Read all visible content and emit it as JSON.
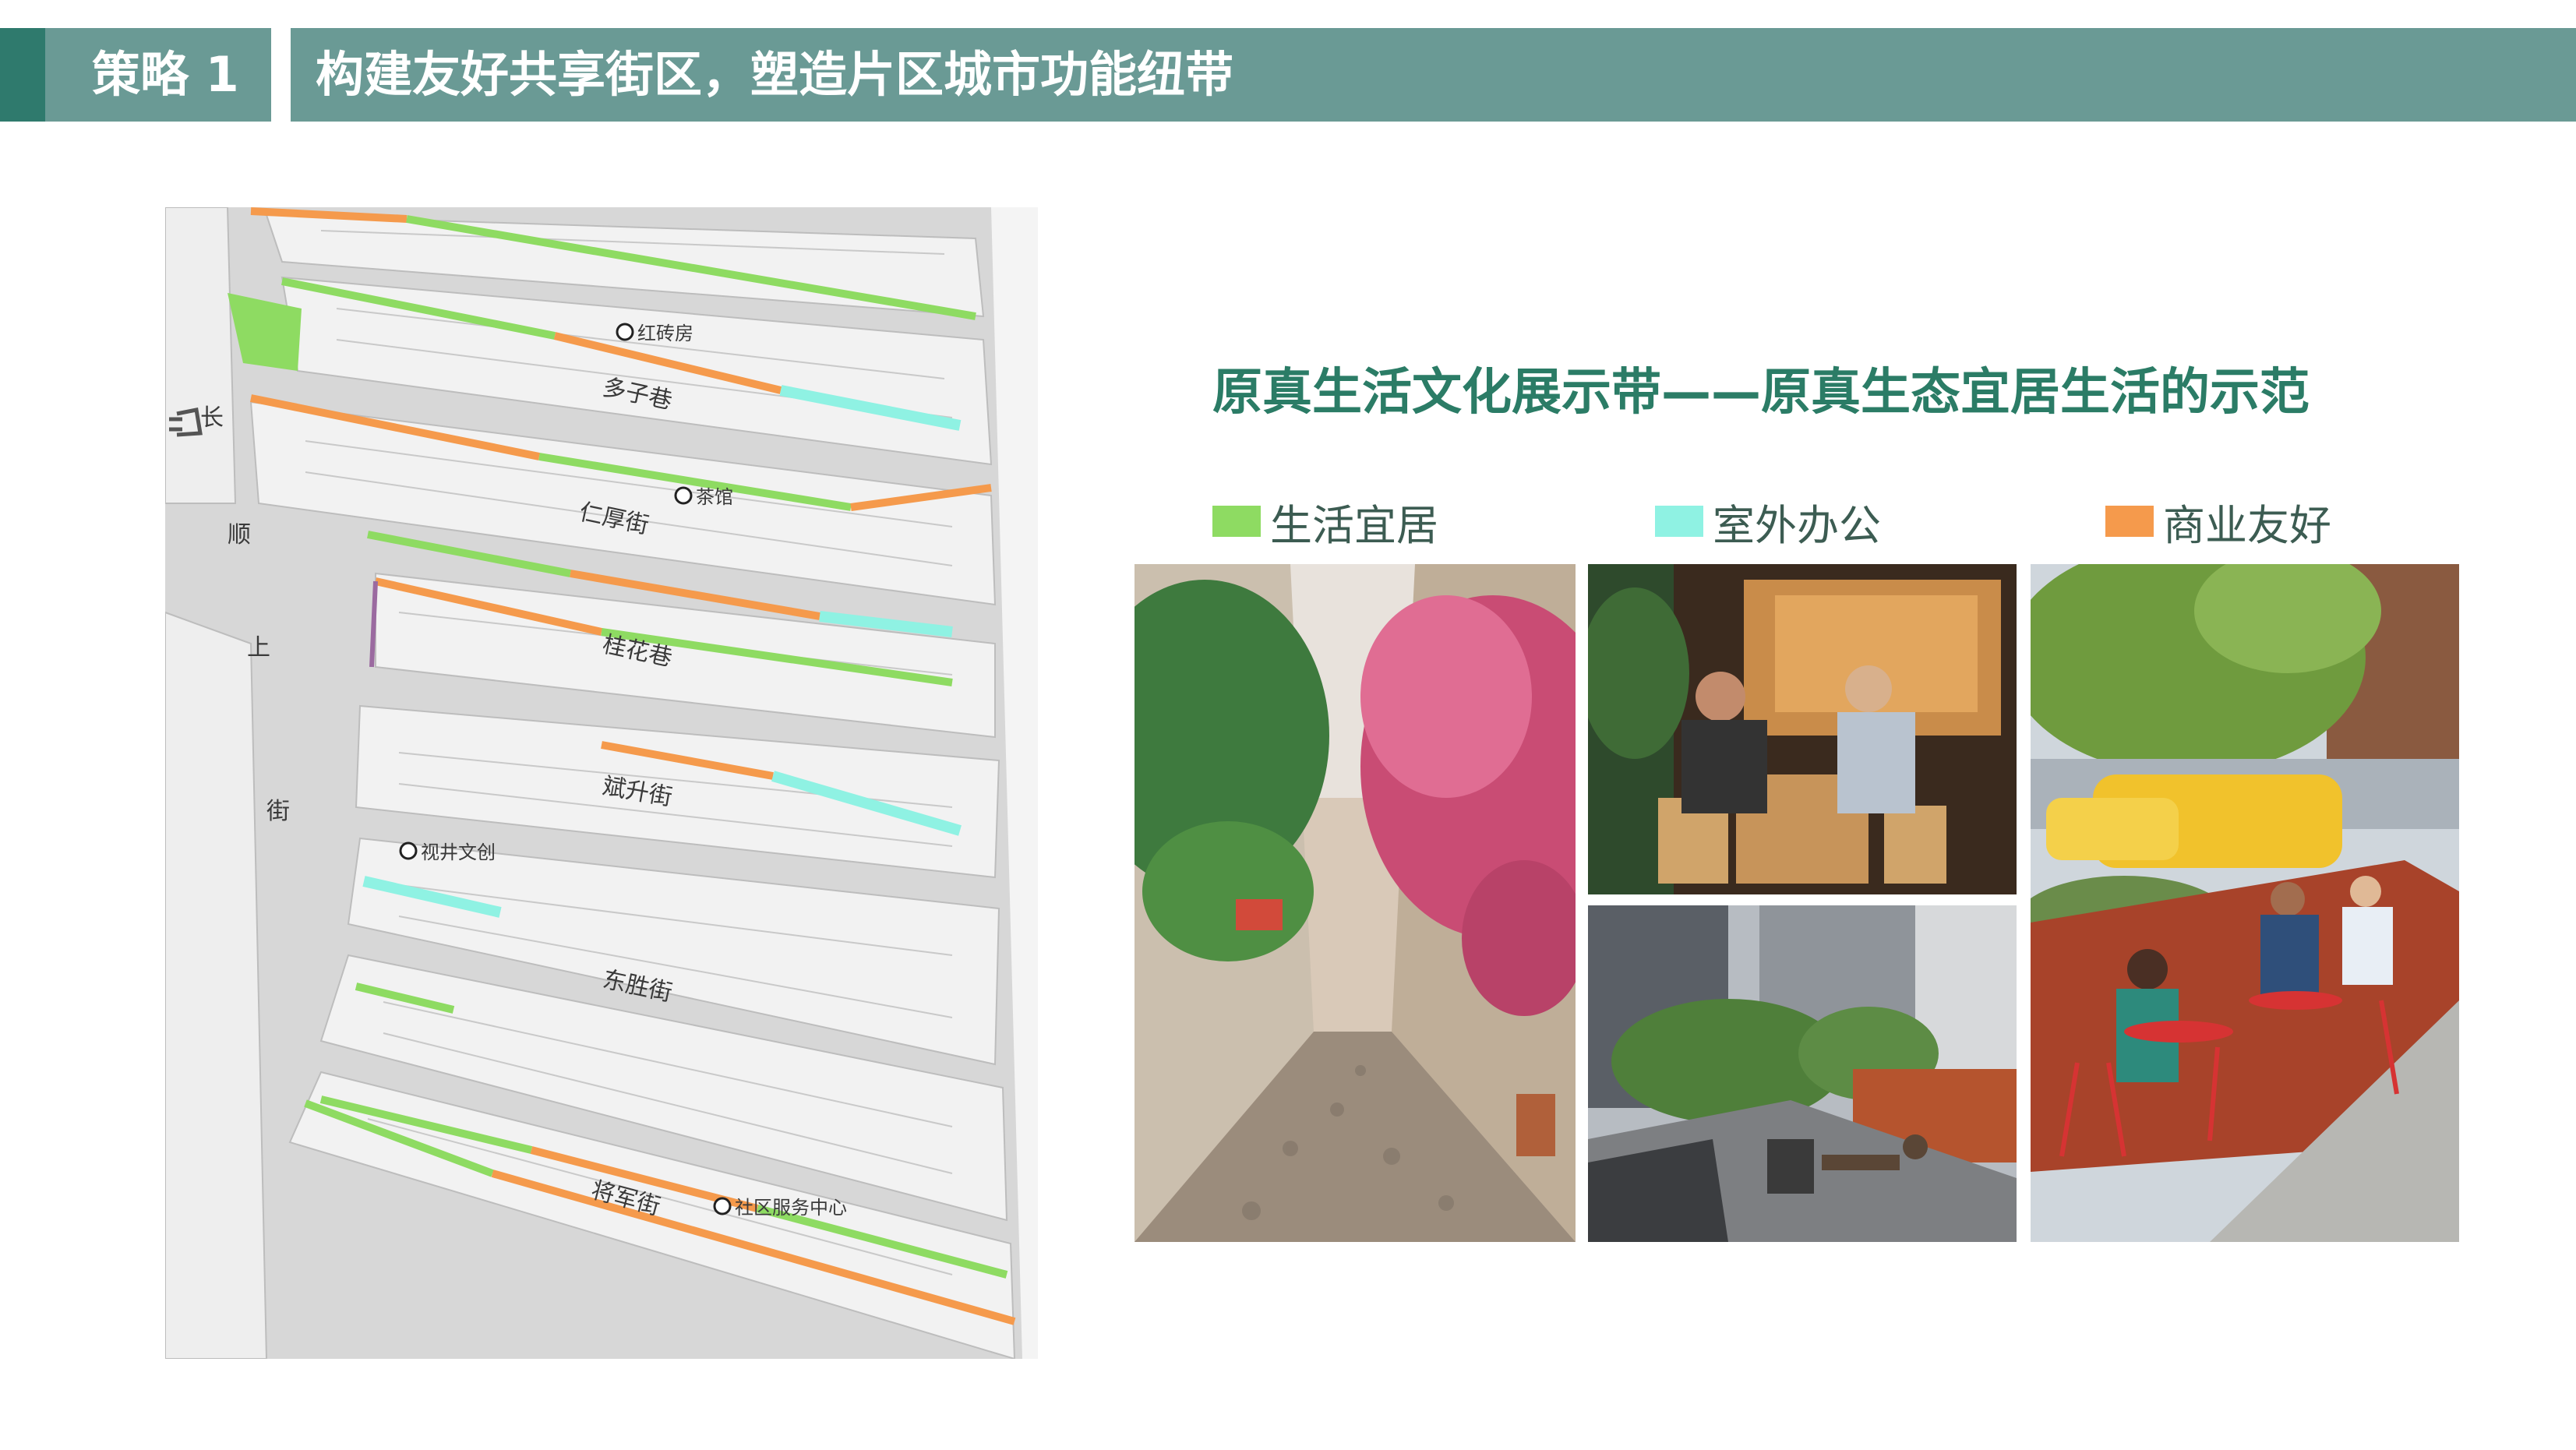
{
  "header": {
    "strategy_label": "策略 1",
    "title": "构建友好共享街区，塑造片区城市功能纽带"
  },
  "map": {
    "streets": [
      {
        "label": "多子巷"
      },
      {
        "label": "仁厚街"
      },
      {
        "label": "桂花巷"
      },
      {
        "label": "斌升街"
      },
      {
        "label": "东胜街"
      },
      {
        "label": "将军街"
      }
    ],
    "main_road": [
      "长",
      "顺",
      "上",
      "街"
    ],
    "landmarks": [
      {
        "label": "红砖房"
      },
      {
        "label": "茶馆"
      },
      {
        "label": "视井文创"
      },
      {
        "label": "社区服务中心"
      }
    ]
  },
  "section_title": "原真生活文化展示带——原真生态宜居生活的示范",
  "legend": [
    {
      "label": "生活宜居",
      "color": "#8edb62"
    },
    {
      "label": "室外办公",
      "color": "#8ff2e3"
    },
    {
      "label": "商业友好",
      "color": "#f59a4c"
    }
  ],
  "photos": [
    {
      "name": "flower-alley-photo"
    },
    {
      "name": "cafe-interior-photo"
    },
    {
      "name": "plaza-seating-photo"
    },
    {
      "name": "parklet-street-photo"
    }
  ],
  "colors": {
    "header_bg": "#6a9a95",
    "header_accent": "#2f7a6d",
    "title_green": "#2b7c66"
  }
}
